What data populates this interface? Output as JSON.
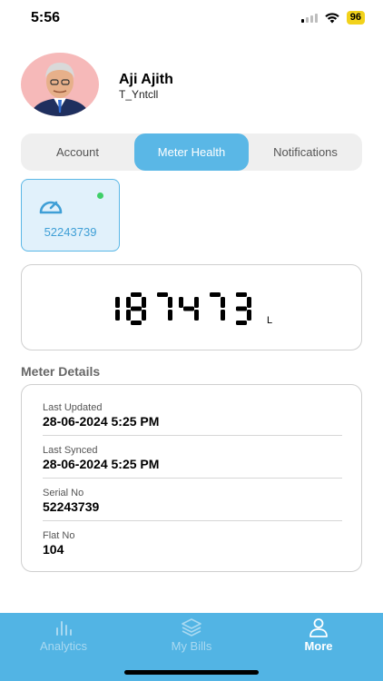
{
  "status_bar": {
    "time": "5:56",
    "battery": "96"
  },
  "profile": {
    "name": "Aji Ajith",
    "username": "T_Yntcll"
  },
  "tabs": [
    {
      "label": "Account",
      "active": false
    },
    {
      "label": "Meter Health",
      "active": true
    },
    {
      "label": "Notifications",
      "active": false
    }
  ],
  "meter_card": {
    "serial": "52243739",
    "status_color": "#3fcf68",
    "icon": "gauge-icon"
  },
  "reading": {
    "value": "187473",
    "unit": "L"
  },
  "details": {
    "title": "Meter Details",
    "rows": [
      {
        "label": "Last Updated",
        "value": "28-06-2024 5:25 PM"
      },
      {
        "label": "Last Synced",
        "value": "28-06-2024 5:25 PM"
      },
      {
        "label": "Serial No",
        "value": "52243739"
      },
      {
        "label": "Flat No",
        "value": "104"
      }
    ]
  },
  "bottom_nav": [
    {
      "label": "Analytics",
      "icon": "bar-chart-icon",
      "active": false
    },
    {
      "label": "My Bills",
      "icon": "layers-icon",
      "active": false
    },
    {
      "label": "More",
      "icon": "user-icon",
      "active": true
    }
  ],
  "colors": {
    "accent": "#5ab7e6",
    "nav_bg": "#52b4e4",
    "status_ok": "#3fcf68"
  }
}
